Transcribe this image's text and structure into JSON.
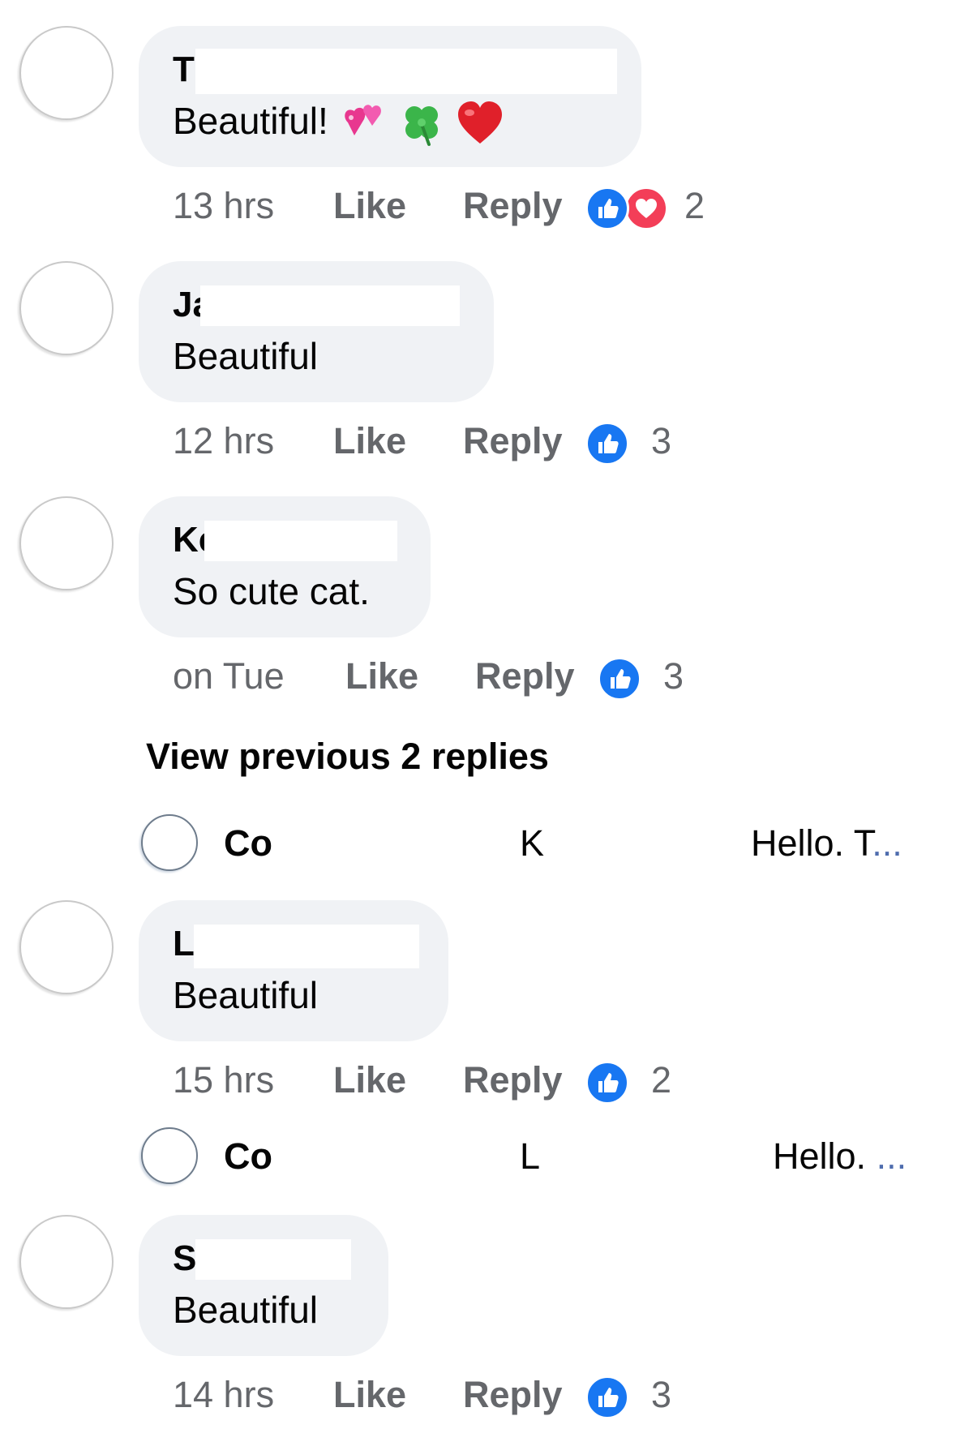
{
  "colors": {
    "bubble": "#f0f2f5",
    "meta_text": "#65676b",
    "like_blue": "#1877f2",
    "love_red": "#f33e58",
    "ellipsis": "#4f6dae"
  },
  "icons": {
    "like": "thumbs-up-icon",
    "love": "heart-icon"
  },
  "comments": [
    {
      "name": "T",
      "text": "Beautiful!",
      "emojis": [
        "two-hearts-emoji",
        "four-leaf-clover-emoji",
        "red-heart-emoji"
      ],
      "time": "13 hrs",
      "like_label": "Like",
      "reply_label": "Reply",
      "reactions": [
        "like",
        "love"
      ],
      "reaction_count": "2"
    },
    {
      "name": "Ja",
      "text": "Beautiful",
      "time": "12 hrs",
      "like_label": "Like",
      "reply_label": "Reply",
      "reactions": [
        "like"
      ],
      "reaction_count": "3"
    },
    {
      "name": "Ke",
      "text": "So cute cat.",
      "time": "on Tue",
      "like_label": "Like",
      "reply_label": "Reply",
      "reactions": [
        "like"
      ],
      "reaction_count": "3"
    },
    {
      "name": "L",
      "text": "Beautiful",
      "time": "15 hrs",
      "like_label": "Like",
      "reply_label": "Reply",
      "reactions": [
        "like"
      ],
      "reaction_count": "2"
    },
    {
      "name": "S",
      "text": "Beautiful",
      "time": "14 hrs",
      "like_label": "Like",
      "reply_label": "Reply",
      "reactions": [
        "like"
      ],
      "reaction_count": "3"
    }
  ],
  "view_previous_replies": "View previous 2 replies",
  "reply_previews": [
    {
      "name": "Co",
      "mention": "K",
      "text": "Hello. T",
      "ellipsis": "..."
    },
    {
      "name": "Co",
      "mention": "L",
      "text": "Hello. ",
      "ellipsis": "..."
    }
  ]
}
